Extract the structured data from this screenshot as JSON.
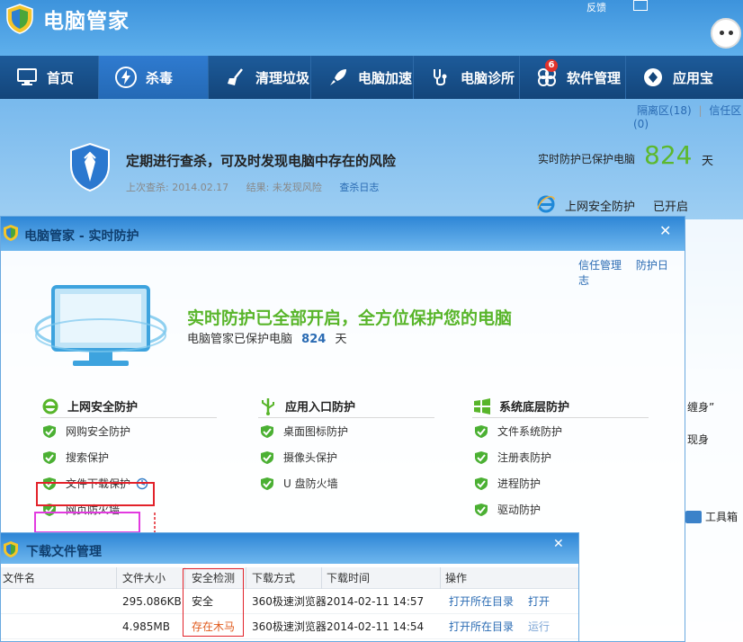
{
  "app": {
    "title": "电脑管家",
    "top_tools": [
      "反馈"
    ],
    "quarantine_link": "隔离区(18)",
    "trust_link": "信任区(0)"
  },
  "nav": {
    "items": [
      {
        "label": "首页",
        "icon": "monitor-icon"
      },
      {
        "label": "杀毒",
        "icon": "lightning-icon",
        "active": true
      },
      {
        "label": "清理垃圾",
        "icon": "broom-icon"
      },
      {
        "label": "电脑加速",
        "icon": "rocket-icon"
      },
      {
        "label": "电脑诊所",
        "icon": "stethoscope-icon"
      },
      {
        "label": "软件管理",
        "icon": "apps-icon",
        "badge": "6"
      },
      {
        "label": "应用宝",
        "icon": "app-store-icon"
      }
    ]
  },
  "scan": {
    "advice": "定期进行查杀，可及时发现电脑中存在的风险",
    "last_scan": "上次查杀: 2014.02.17",
    "result": "结果: 未发现风险",
    "log_link": "查杀日志"
  },
  "side": {
    "protected_label": "实时防护已保护电脑",
    "protected_days": "824",
    "days_unit": "天",
    "web_protect_label": "上网安全防护",
    "web_protect_status": "已开启",
    "partial_text_1": "缠身”",
    "partial_text_2": "现身",
    "toolbox": "工具箱"
  },
  "realtime": {
    "title": "电脑管家 - 实时防护",
    "trust_mgmt": "信任管理",
    "protect_log": "防护日志",
    "headline": "实时防护已全部开启，全方位保护您的电脑",
    "sub_prefix": "电脑管家已保护电脑",
    "sub_days": "824",
    "sub_suffix": "天",
    "columns": [
      {
        "title": "上网安全防护",
        "icon": "ie-icon",
        "items": [
          "网购安全防护",
          "搜索保护",
          "文件下载保护",
          "网页防火墙"
        ]
      },
      {
        "title": "应用入口防护",
        "icon": "usb-icon",
        "items": [
          "桌面图标防护",
          "摄像头保护",
          "U 盘防火墙"
        ]
      },
      {
        "title": "系统底层防护",
        "icon": "windows-icon",
        "items": [
          "文件系统防护",
          "注册表防护",
          "进程防护",
          "驱动防护"
        ]
      }
    ]
  },
  "download": {
    "title": "下载文件管理",
    "headers": [
      "文件名",
      "文件大小",
      "安全检测",
      "下载方式",
      "下载时间",
      "操作"
    ],
    "rows": [
      {
        "name": "",
        "size": "295.086KB",
        "security": "安全",
        "method": "360极速浏览器",
        "time": "2014-02-11 14:57",
        "open_dir": "打开所在目录",
        "action": "打开"
      },
      {
        "name": "",
        "size": "4.985MB",
        "security": "存在木马",
        "method": "360极速浏览器",
        "time": "2014-02-11 14:54",
        "open_dir": "打开所在目录",
        "action": "运行"
      }
    ]
  },
  "colors": {
    "accent_green": "#58b52a",
    "link_blue": "#2a6bb3",
    "nav_bg": "#13457a",
    "warning_orange": "#e05a1c",
    "highlight_red": "#e2222a",
    "highlight_magenta": "#e23ae0"
  }
}
